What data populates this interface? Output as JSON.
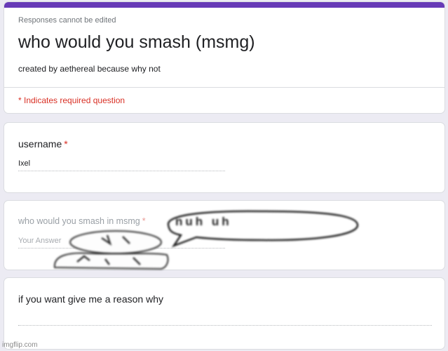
{
  "form": {
    "notice": "Responses cannot be edited",
    "title": "who would you smash (msmg)",
    "description": "created by aethereal because why not",
    "required_note": "* Indicates required question",
    "accent_color": "#673ab7"
  },
  "questions": [
    {
      "label": "username",
      "required_mark": "*",
      "answer_value": "Ixel"
    },
    {
      "label": "who would you smash in msmg",
      "required_mark": "*",
      "answer_placeholder": "Your Answer"
    },
    {
      "label": "if you want give me a reason why"
    }
  ],
  "overlay": {
    "speech_bubble_text": "nuh uh",
    "creature_icon": "doodle-character-icon"
  },
  "watermark": "imgflip.com"
}
